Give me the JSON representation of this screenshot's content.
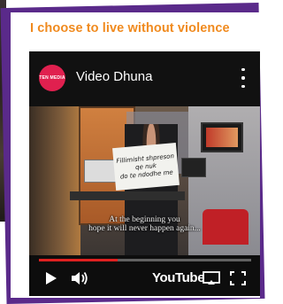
{
  "headline": "I choose to live without violence",
  "player": {
    "channel_name": "Video Dhuna",
    "channel_logo_text": "TEN MEDIA",
    "subtitle_line1": "At the beginning you",
    "subtitle_line2": "hope it will never happen again...",
    "sign_lines": [
      "Fillimisht shpreson",
      "qe nuk",
      "do te ndodhe me"
    ],
    "progress_fraction": 0.37,
    "brand_label": "YouTube"
  },
  "colors": {
    "headline": "#f08a1e",
    "frame_purple": "#5a2a8a",
    "progress": "#e02020",
    "channel_avatar": "#e0204f"
  }
}
